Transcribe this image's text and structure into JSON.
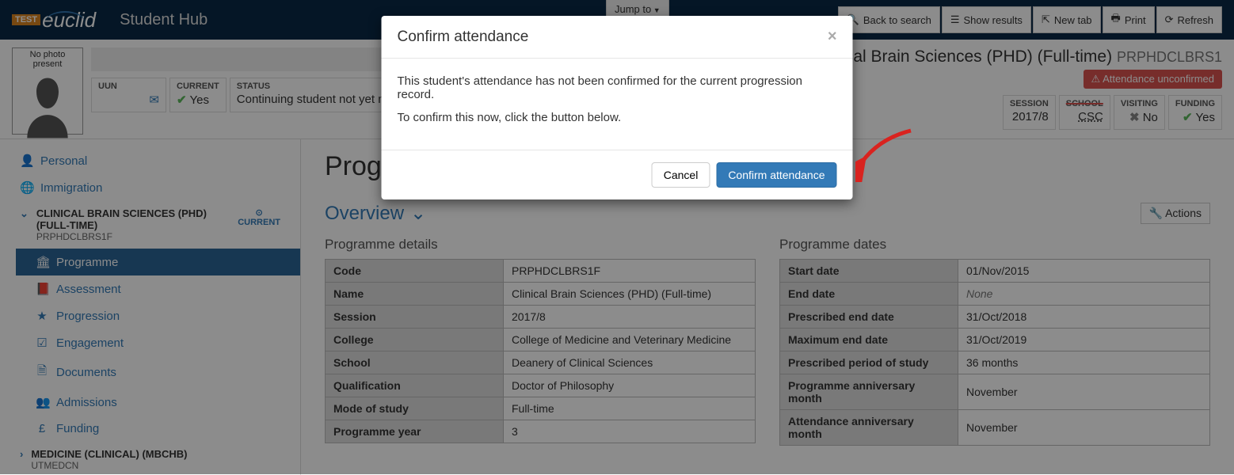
{
  "navbar": {
    "logo_test": "TEST",
    "logo_name": "euclid",
    "app_title": "Student Hub",
    "jump_to": "Jump to"
  },
  "toolbar": {
    "back": "Back to search",
    "show": "Show results",
    "newtab": "New tab",
    "print": "Print",
    "refresh": "Refresh"
  },
  "student": {
    "photo_placeholder": "No photo present",
    "programme_title": " - Clinical Brain Sciences (PHD) (Full-time)",
    "programme_code_suffix": "PRPHDCLBRS1",
    "attendance_badge": "Attendance unconfirmed",
    "fields": {
      "uun": {
        "label": "UUN",
        "value": ""
      },
      "current": {
        "label": "CURRENT",
        "value": "Yes"
      },
      "status": {
        "label": "STATUS",
        "value": "Continuing student not yet ma"
      },
      "session": {
        "label": "SESSION",
        "value": "2017/8"
      },
      "school": {
        "label": "SCHOOL",
        "value": "CSC"
      },
      "visiting": {
        "label": "VISITING",
        "value": "No"
      },
      "funding": {
        "label": "FUNDING",
        "value": "Yes"
      }
    }
  },
  "sidebar": {
    "personal": "Personal",
    "immigration": "Immigration",
    "group1": {
      "name": "CLINICAL BRAIN SCIENCES (PHD) (FULL-TIME)",
      "code": "PRPHDCLBRS1F",
      "current": "CURRENT"
    },
    "programme": "Programme",
    "assessment": "Assessment",
    "progression": "Progression",
    "engagement": "Engagement",
    "documents": "Documents",
    "admissions": "Admissions",
    "funding": "Funding",
    "group2": {
      "name": "MEDICINE (CLINICAL) (MBCHB)",
      "code": "UTMEDCN"
    }
  },
  "content": {
    "page_title": "Progra",
    "section": "Overview",
    "actions": "Actions",
    "details_h": "Programme details",
    "dates_h": "Programme dates",
    "details": [
      {
        "k": "Code",
        "v": "PRPHDCLBRS1F"
      },
      {
        "k": "Name",
        "v": "Clinical Brain Sciences (PHD) (Full-time)"
      },
      {
        "k": "Session",
        "v": "2017/8"
      },
      {
        "k": "College",
        "v": "College of Medicine and Veterinary Medicine"
      },
      {
        "k": "School",
        "v": "Deanery of Clinical Sciences"
      },
      {
        "k": "Qualification",
        "v": "Doctor of Philosophy"
      },
      {
        "k": "Mode of study",
        "v": "Full-time"
      },
      {
        "k": "Programme year",
        "v": "3"
      }
    ],
    "dates": [
      {
        "k": "Start date",
        "v": "01/Nov/2015"
      },
      {
        "k": "End date",
        "v": "None",
        "none": true
      },
      {
        "k": "Prescribed end date",
        "v": "31/Oct/2018"
      },
      {
        "k": "Maximum end date",
        "v": "31/Oct/2019"
      },
      {
        "k": "Prescribed period of study",
        "v": "36 months"
      },
      {
        "k": "Programme anniversary month",
        "v": "November"
      },
      {
        "k": "Attendance anniversary month",
        "v": "November"
      }
    ]
  },
  "modal": {
    "title": "Confirm attendance",
    "line1": "This student's attendance has not been confirmed for the current progression record.",
    "line2": "To confirm this now, click the button below.",
    "cancel": "Cancel",
    "confirm": "Confirm attendance"
  }
}
